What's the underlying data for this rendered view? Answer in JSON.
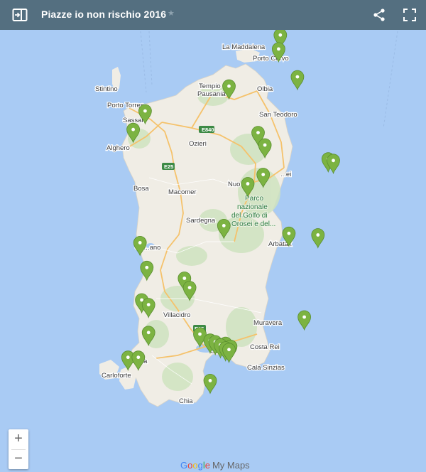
{
  "header": {
    "title": "Piazze io non rischio 2016",
    "star": "★"
  },
  "places": [
    {
      "id": "la-maddalena",
      "name": "La Maddalena"
    },
    {
      "id": "porto-cervo",
      "name": "Porto Cervo"
    },
    {
      "id": "stintino",
      "name": "Stintino"
    },
    {
      "id": "tempio",
      "name": "Tempio\nPausania"
    },
    {
      "id": "olbia",
      "name": "Olbia"
    },
    {
      "id": "porto-torres",
      "name": "Porto Torres"
    },
    {
      "id": "san-teodoro",
      "name": "San Teodoro"
    },
    {
      "id": "sassari",
      "name": "Sassari"
    },
    {
      "id": "alghero",
      "name": "Alghero"
    },
    {
      "id": "ozieri",
      "name": "Ozieri"
    },
    {
      "id": "siniscola",
      "name": "...ei"
    },
    {
      "id": "nuoro",
      "name": "Nuo"
    },
    {
      "id": "bosa",
      "name": "Bosa"
    },
    {
      "id": "macomer",
      "name": "Macomer"
    },
    {
      "id": "sardegna",
      "name": "Sardegna"
    },
    {
      "id": "oristano",
      "name": "Ori...ano"
    },
    {
      "id": "arbatax",
      "name": "Arbatax"
    },
    {
      "id": "villacidro",
      "name": "Villacidro"
    },
    {
      "id": "muravera",
      "name": "Muravera"
    },
    {
      "id": "costa-rei",
      "name": "Costa Rei"
    },
    {
      "id": "cagliari",
      "name": "Ca...ri"
    },
    {
      "id": "carbonia",
      "name": "Ca...ia"
    },
    {
      "id": "carloforte",
      "name": "Carloforte"
    },
    {
      "id": "cala-sinzias",
      "name": "Cala Sinzias"
    },
    {
      "id": "chia",
      "name": "Chia"
    }
  ],
  "park_label": [
    "Parco",
    "nazionale",
    "del Golfo di",
    "Orosei e del..."
  ],
  "roads": [
    {
      "id": "e840",
      "name": "E840"
    },
    {
      "id": "e25",
      "name": "E25"
    },
    {
      "id": "e25b",
      "name": "E25"
    }
  ],
  "markers": [
    {
      "lat": 41.23,
      "lon": 9.41
    },
    {
      "lat": 41.14,
      "lon": 9.4
    },
    {
      "lat": 40.96,
      "lon": 9.51
    },
    {
      "lat": 40.9,
      "lon": 9.11
    },
    {
      "lat": 40.74,
      "lon": 8.62
    },
    {
      "lat": 40.62,
      "lon": 8.55
    },
    {
      "lat": 40.6,
      "lon": 9.28
    },
    {
      "lat": 40.52,
      "lon": 9.32
    },
    {
      "lat": 40.43,
      "lon": 9.69
    },
    {
      "lat": 40.42,
      "lon": 9.72
    },
    {
      "lat": 40.33,
      "lon": 9.31
    },
    {
      "lat": 40.27,
      "lon": 9.22
    },
    {
      "lat": 40.0,
      "lon": 9.08
    },
    {
      "lat": 39.95,
      "lon": 9.46
    },
    {
      "lat": 39.94,
      "lon": 9.63
    },
    {
      "lat": 39.89,
      "lon": 8.59
    },
    {
      "lat": 39.73,
      "lon": 8.63
    },
    {
      "lat": 39.66,
      "lon": 8.85
    },
    {
      "lat": 39.6,
      "lon": 8.88
    },
    {
      "lat": 39.52,
      "lon": 8.6
    },
    {
      "lat": 39.49,
      "lon": 8.64
    },
    {
      "lat": 39.41,
      "lon": 9.55
    },
    {
      "lat": 39.31,
      "lon": 8.64
    },
    {
      "lat": 39.3,
      "lon": 8.94
    },
    {
      "lat": 39.26,
      "lon": 9.0
    },
    {
      "lat": 39.25,
      "lon": 9.03
    },
    {
      "lat": 39.24,
      "lon": 9.09
    },
    {
      "lat": 39.23,
      "lon": 9.06
    },
    {
      "lat": 39.22,
      "lon": 9.12
    },
    {
      "lat": 39.21,
      "lon": 9.09
    },
    {
      "lat": 39.2,
      "lon": 9.11
    },
    {
      "lat": 39.15,
      "lon": 8.52
    },
    {
      "lat": 39.15,
      "lon": 8.58
    },
    {
      "lat": 39.0,
      "lon": 9.0
    }
  ],
  "zoom": {
    "in": "+",
    "out": "−"
  },
  "footer": {
    "google": "Google",
    "mymaps": "My Maps"
  },
  "colors": {
    "sea": "#a9cbf4",
    "land": "#f0ede5",
    "header": "#546f80",
    "marker": "#7cb342"
  }
}
